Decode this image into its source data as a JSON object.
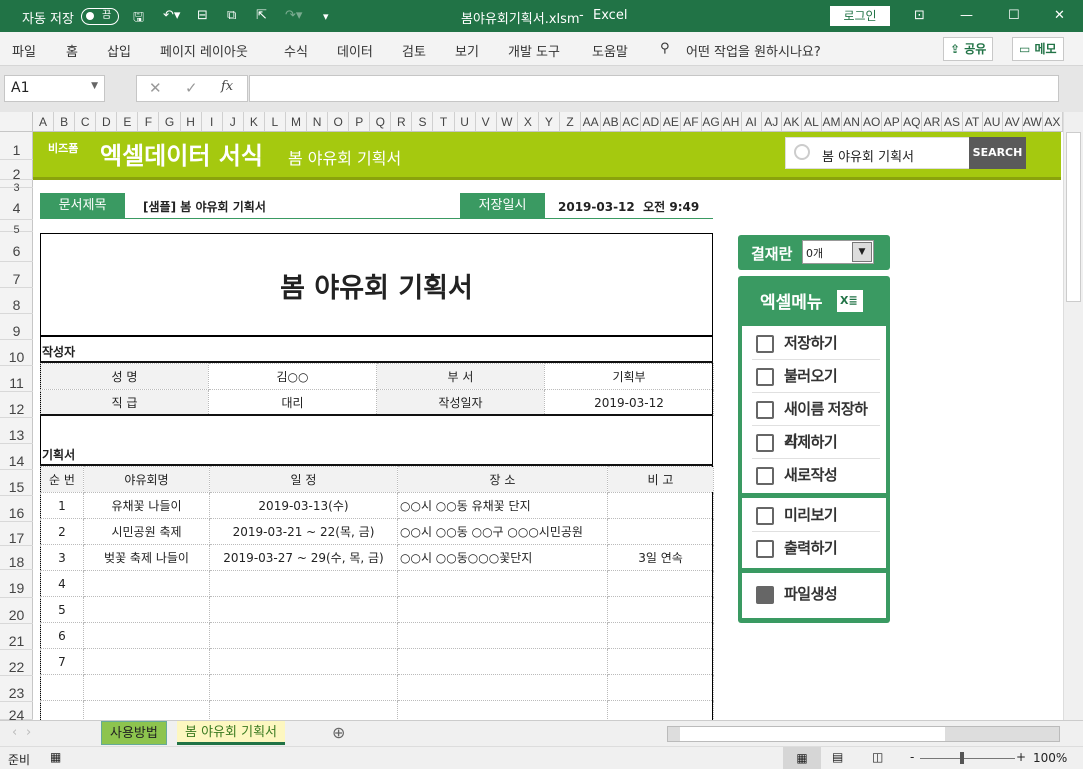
{
  "titlebar": {
    "autosave": "자동 저장",
    "toggle": "끔",
    "filename": "봄야유회기획서.xlsm",
    "sep": "-",
    "app": "Excel",
    "login": "로그인"
  },
  "ribbon": {
    "tabs": [
      "파일",
      "홈",
      "삽입",
      "페이지 레이아웃",
      "수식",
      "데이터",
      "검토",
      "보기",
      "개발 도구",
      "도움말"
    ],
    "tell_me": "어떤 작업을 원하시나요?",
    "share": "공유",
    "comment": "메모"
  },
  "formula_bar": {
    "name_box": "A1",
    "fx": "fx",
    "value": ""
  },
  "columns": [
    "A",
    "B",
    "C",
    "D",
    "E",
    "F",
    "G",
    "H",
    "I",
    "J",
    "K",
    "L",
    "M",
    "N",
    "O",
    "P",
    "Q",
    "R",
    "S",
    "T",
    "U",
    "V",
    "W",
    "X",
    "Y",
    "Z",
    "AA",
    "AB",
    "AC",
    "AD",
    "AE",
    "AF",
    "AG",
    "AH",
    "AI",
    "AJ",
    "AK",
    "AL",
    "AM",
    "AN",
    "AO",
    "AP",
    "AQ",
    "AR",
    "AS",
    "AT",
    "AU",
    "AV",
    "AW",
    "AX"
  ],
  "rows": [
    "1",
    "2",
    "3",
    "4",
    "5",
    "6",
    "7",
    "8",
    "9",
    "10",
    "11",
    "12",
    "13",
    "14",
    "15",
    "16",
    "17",
    "18",
    "19",
    "20",
    "21",
    "22",
    "23",
    "24"
  ],
  "banner": {
    "brand_small": "비즈폼",
    "brand": "엑셀데이터 서식",
    "subtitle": "봄 야유회 기획서",
    "search_value": "봄 야유회 기획서",
    "search_button": "SEARCH"
  },
  "doc_info": {
    "title_label": "문서제목",
    "title_value": "[샘플] 봄 야유회 기획서",
    "saved_label": "저장일시",
    "saved_value": "2019-03-12  오전 9:49"
  },
  "document": {
    "title": "봄 야유회 기획서",
    "writer_section": "작성자",
    "writer": [
      [
        "성 명",
        "김○○",
        "부 서",
        "기획부"
      ],
      [
        "직 급",
        "대리",
        "작성일자",
        "2019-03-12"
      ]
    ],
    "plan_section": "기획서",
    "plan_headers": [
      "순 번",
      "야유회명",
      "일 정",
      "장 소",
      "비 고"
    ],
    "plan_rows": [
      [
        "1",
        "유채꽃 나들이",
        "2019-03-13(수)",
        "○○시 ○○동 유채꽃 단지",
        ""
      ],
      [
        "2",
        "시민공원 축제",
        "2019-03-21 ~ 22(목, 금)",
        "○○시 ○○동 ○○구 ○○○시민공원",
        ""
      ],
      [
        "3",
        "벚꽃 축제 나들이",
        "2019-03-27 ~ 29(수, 목, 금)",
        "○○시 ○○동○○○꽃단지",
        "3일 연속"
      ],
      [
        "4",
        "",
        "",
        "",
        ""
      ],
      [
        "5",
        "",
        "",
        "",
        ""
      ],
      [
        "6",
        "",
        "",
        "",
        ""
      ],
      [
        "7",
        "",
        "",
        "",
        ""
      ],
      [
        "",
        "",
        "",
        "",
        ""
      ],
      [
        "",
        "",
        "",
        "",
        ""
      ]
    ]
  },
  "side": {
    "approval_label": "결재란",
    "approval_value": "0개",
    "menu_title": "엑셀메뉴",
    "menu": [
      "저장하기",
      "불러오기",
      "새이름 저장하기",
      "삭제하기",
      "새로작성",
      "미리보기",
      "출력하기",
      "파일생성"
    ]
  },
  "sheets": [
    "사용방법",
    "봄 야유회 기획서"
  ],
  "status": {
    "ready": "준비",
    "zoom": "100%"
  },
  "colors": {
    "excel_green": "#217346",
    "banner": "#a5c90f",
    "label_green": "#3a9a62"
  }
}
